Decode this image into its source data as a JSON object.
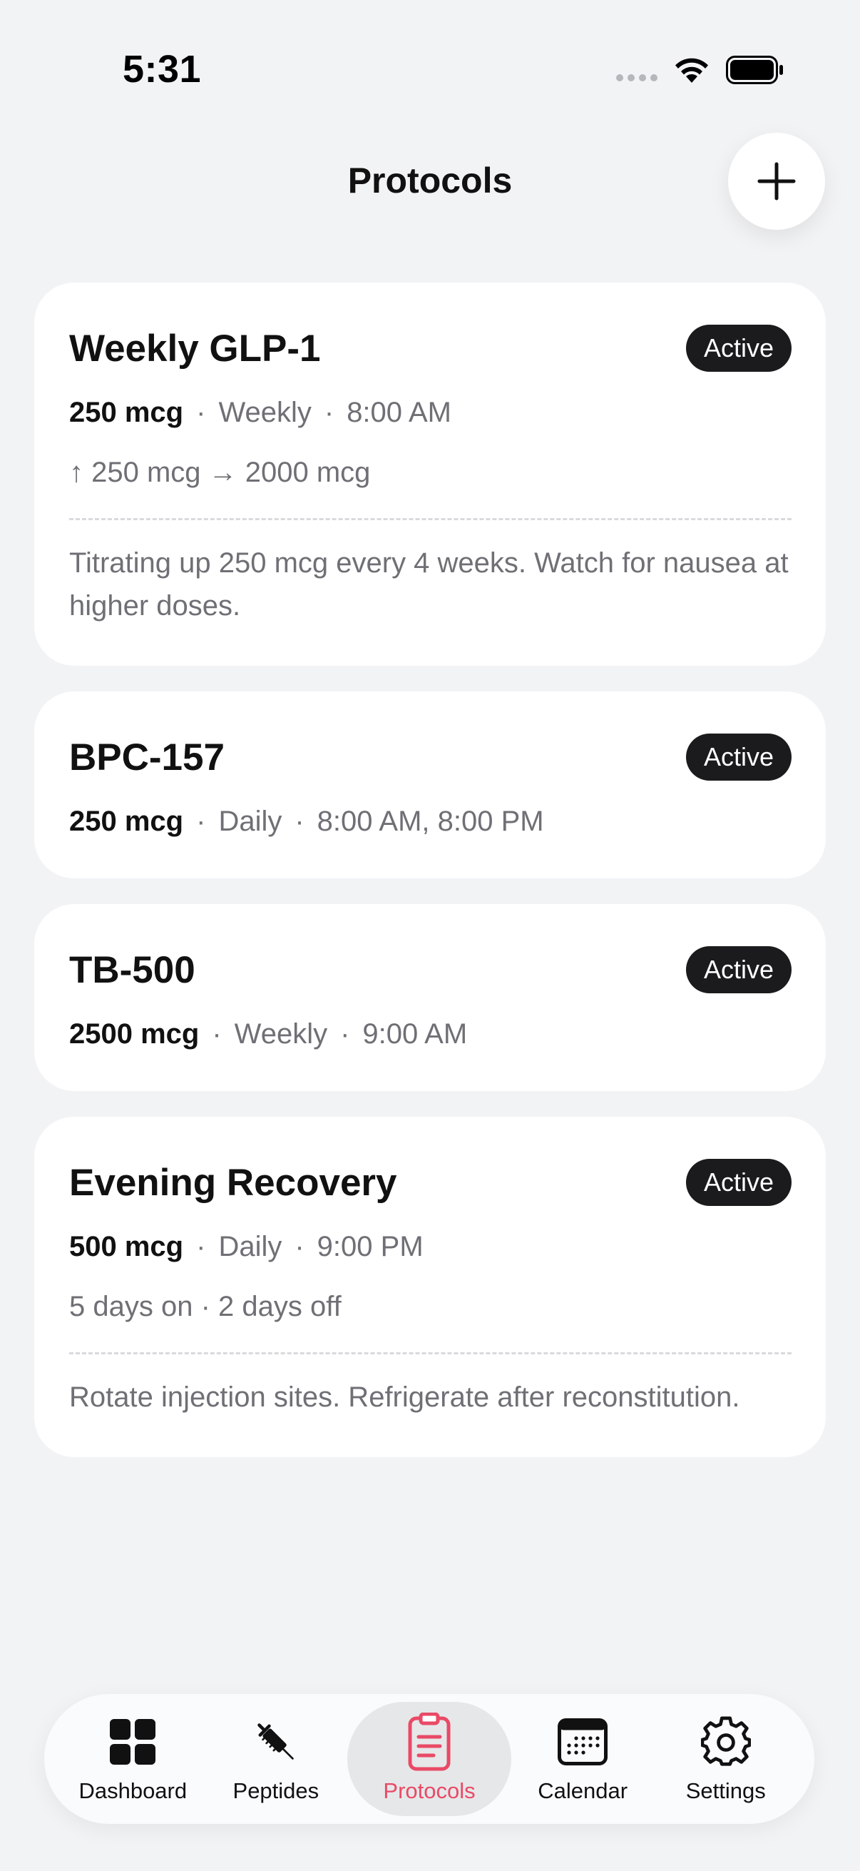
{
  "status_bar": {
    "time": "5:31"
  },
  "header": {
    "title": "Protocols"
  },
  "protocols": [
    {
      "name": "Weekly GLP-1",
      "status": "Active",
      "dose": "250 mcg",
      "frequency": "Weekly",
      "times": "8:00 AM",
      "extra": "↑ 250 mcg → 2000 mcg",
      "note": "Titrating up 250 mcg every 4 weeks. Watch for nausea at higher doses."
    },
    {
      "name": "BPC-157",
      "status": "Active",
      "dose": "250 mcg",
      "frequency": "Daily",
      "times": "8:00 AM, 8:00 PM"
    },
    {
      "name": "TB-500",
      "status": "Active",
      "dose": "2500 mcg",
      "frequency": "Weekly",
      "times": "9:00 AM"
    },
    {
      "name": "Evening Recovery",
      "status": "Active",
      "dose": "500 mcg",
      "frequency": "Daily",
      "times": "9:00 PM",
      "extra": "5 days on · 2 days off",
      "note": "Rotate injection sites. Refrigerate after reconstitution."
    }
  ],
  "tabs": [
    {
      "label": "Dashboard",
      "icon": "grid-icon"
    },
    {
      "label": "Peptides",
      "icon": "syringe-icon"
    },
    {
      "label": "Protocols",
      "icon": "clipboard-icon",
      "active": true
    },
    {
      "label": "Calendar",
      "icon": "calendar-icon"
    },
    {
      "label": "Settings",
      "icon": "gear-icon"
    }
  ],
  "colors": {
    "background": "#f2f3f5",
    "card": "#ffffff",
    "badge": "#1b1b1d",
    "accent": "#e94a66",
    "muted_text": "#6f7075"
  }
}
